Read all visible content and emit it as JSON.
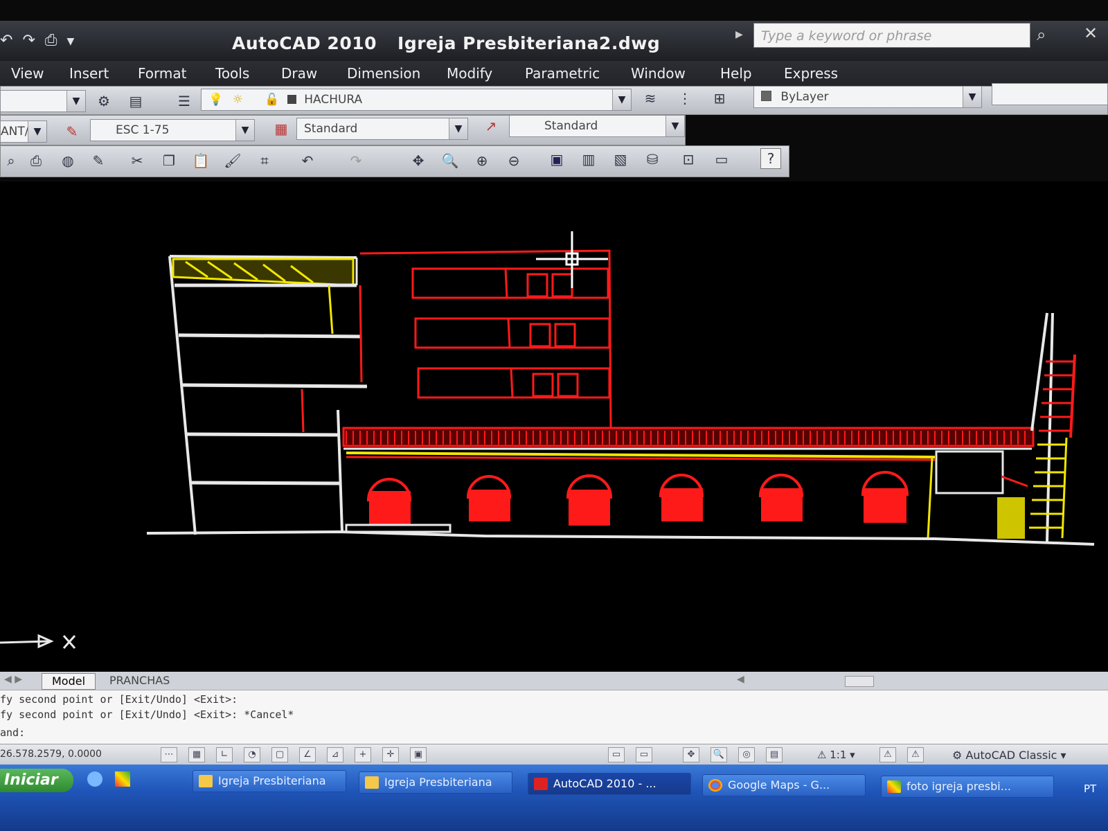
{
  "app": {
    "title": "AutoCAD 2010",
    "document": "Igreja Presbiteriana2.dwg"
  },
  "search": {
    "placeholder": "Type a keyword or phrase"
  },
  "menu": [
    "View",
    "Insert",
    "Format",
    "Tools",
    "Draw",
    "Dimension",
    "Modify",
    "Parametric",
    "Window",
    "Help",
    "Express"
  ],
  "layers": {
    "current_layer": "HACHURA",
    "color": "ByLayer"
  },
  "styles": {
    "text_style": "ANT/",
    "dim_style": "ESC 1-75",
    "table_style": "Standard",
    "multileader_style": "Standard"
  },
  "tabs": {
    "model": "Model",
    "layout": "PRANCHAS"
  },
  "command_history": [
    "fy second point or [Exit/Undo] <Exit>:",
    "fy second point or [Exit/Undo] <Exit>: *Cancel*",
    "and:"
  ],
  "status": {
    "coordinates": "26.578.2579, 0.0000",
    "annotation_scale": "1:1",
    "workspace": "AutoCAD Classic"
  },
  "taskbar": {
    "start": "Iniciar",
    "items": [
      "Igreja Presbiteriana",
      "Igreja Presbiteriana",
      "AutoCAD 2010 - ...",
      "Google Maps - G...",
      "foto igreja presbi..."
    ],
    "language": "PT"
  },
  "colors": {
    "drawing_red": "#ff1a1a",
    "drawing_yellow": "#f2e600",
    "drawing_white": "#e8e8e8",
    "canvas": "#000000"
  }
}
